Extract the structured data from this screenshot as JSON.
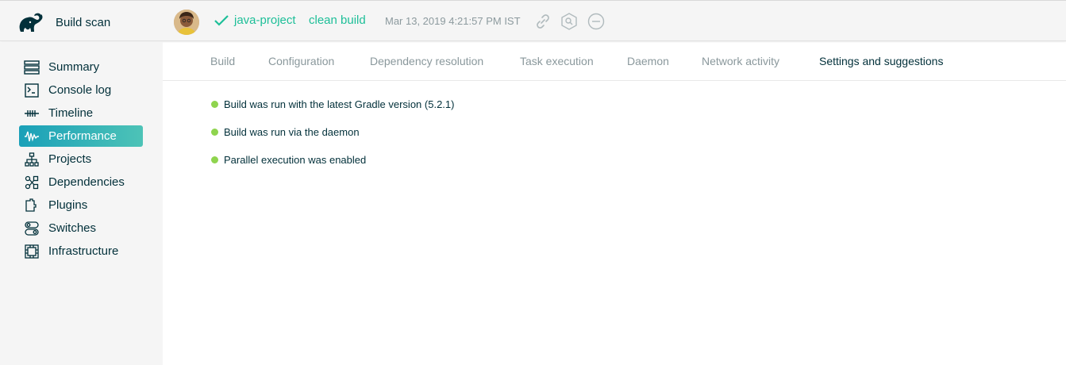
{
  "app": {
    "title": "Build scan"
  },
  "build": {
    "project": "java-project",
    "tasks": "clean build",
    "timestamp": "Mar 13, 2019 4:21:57 PM IST",
    "status": "success"
  },
  "colors": {
    "accent": "#1dbf98",
    "active_start": "#1aa0b8",
    "active_end": "#4dc3b7",
    "ok_dot": "#8fd44e",
    "text": "#02303a",
    "muted": "#8a989c"
  },
  "header_icons": [
    "link-icon",
    "search-icon",
    "minus-circle-icon"
  ],
  "sidebar": {
    "items": [
      {
        "label": "Summary",
        "icon": "summary-icon"
      },
      {
        "label": "Console log",
        "icon": "console-icon"
      },
      {
        "label": "Timeline",
        "icon": "timeline-icon"
      },
      {
        "label": "Performance",
        "icon": "performance-icon",
        "active": true
      },
      {
        "label": "Projects",
        "icon": "projects-icon"
      },
      {
        "label": "Dependencies",
        "icon": "dependencies-icon"
      },
      {
        "label": "Plugins",
        "icon": "plugins-icon"
      },
      {
        "label": "Switches",
        "icon": "switches-icon"
      },
      {
        "label": "Infrastructure",
        "icon": "infrastructure-icon"
      }
    ]
  },
  "tabs": [
    {
      "label": "Build"
    },
    {
      "label": "Configuration"
    },
    {
      "label": "Dependency resolution"
    },
    {
      "label": "Task execution"
    },
    {
      "label": "Daemon"
    },
    {
      "label": "Network activity"
    },
    {
      "label": "Settings and suggestions",
      "active": true
    }
  ],
  "suggestions": [
    {
      "text": "Build was run with the latest Gradle version (5.2.1)",
      "status": "ok"
    },
    {
      "text": "Build was run via the daemon",
      "status": "ok"
    },
    {
      "text": "Parallel execution was enabled",
      "status": "ok"
    }
  ]
}
